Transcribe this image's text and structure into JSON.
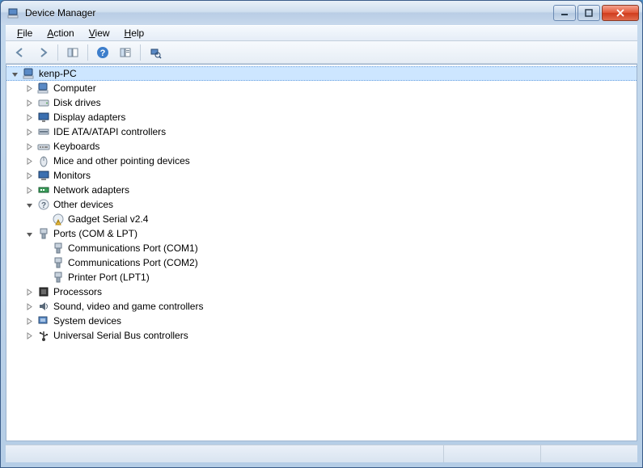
{
  "window": {
    "title": "Device Manager"
  },
  "menu": {
    "file": "File",
    "action": "Action",
    "view": "View",
    "help": "Help"
  },
  "toolbar": {
    "back": "Back",
    "forward": "Forward",
    "showhide": "Show/Hide Console Tree",
    "help": "Help",
    "properties": "Properties",
    "scan": "Scan for hardware changes"
  },
  "tree": {
    "root": {
      "label": "kenp-PC",
      "icon": "computer-icon",
      "expanded": true,
      "selected": true
    },
    "items": [
      {
        "label": "Computer",
        "icon": "computer-icon",
        "expanded": false,
        "children": []
      },
      {
        "label": "Disk drives",
        "icon": "disk-icon",
        "expanded": false,
        "children": []
      },
      {
        "label": "Display adapters",
        "icon": "display-icon",
        "expanded": false,
        "children": []
      },
      {
        "label": "IDE ATA/ATAPI controllers",
        "icon": "ide-icon",
        "expanded": false,
        "children": []
      },
      {
        "label": "Keyboards",
        "icon": "keyboard-icon",
        "expanded": false,
        "children": []
      },
      {
        "label": "Mice and other pointing devices",
        "icon": "mouse-icon",
        "expanded": false,
        "children": []
      },
      {
        "label": "Monitors",
        "icon": "monitor-icon",
        "expanded": false,
        "children": []
      },
      {
        "label": "Network adapters",
        "icon": "network-icon",
        "expanded": false,
        "children": []
      },
      {
        "label": "Other devices",
        "icon": "other-icon",
        "expanded": true,
        "children": [
          {
            "label": "Gadget Serial v2.4",
            "icon": "warning-icon"
          }
        ]
      },
      {
        "label": "Ports (COM & LPT)",
        "icon": "port-icon",
        "expanded": true,
        "children": [
          {
            "label": "Communications Port (COM1)",
            "icon": "port-icon"
          },
          {
            "label": "Communications Port (COM2)",
            "icon": "port-icon"
          },
          {
            "label": "Printer Port (LPT1)",
            "icon": "port-icon"
          }
        ]
      },
      {
        "label": "Processors",
        "icon": "cpu-icon",
        "expanded": false,
        "children": []
      },
      {
        "label": "Sound, video and game controllers",
        "icon": "sound-icon",
        "expanded": false,
        "children": []
      },
      {
        "label": "System devices",
        "icon": "system-icon",
        "expanded": false,
        "children": []
      },
      {
        "label": "Universal Serial Bus controllers",
        "icon": "usb-icon",
        "expanded": false,
        "children": []
      }
    ]
  }
}
